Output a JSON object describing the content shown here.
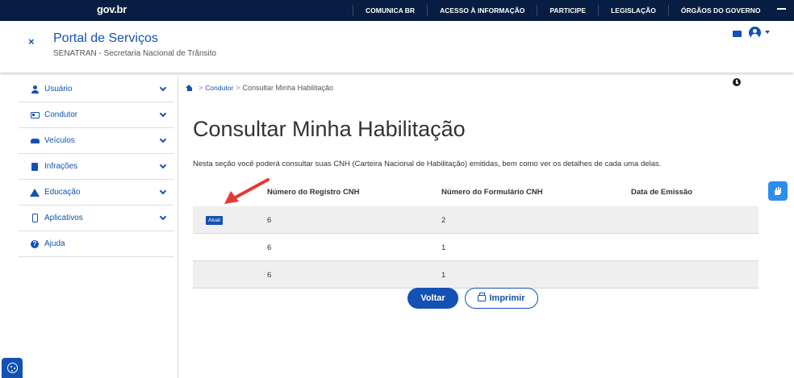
{
  "topbar": {
    "logo": "gov.br",
    "links": [
      "COMUNICA BR",
      "ACESSO À INFORMAÇÃO",
      "PARTICIPE",
      "LEGISLAÇÃO",
      "ÓRGÃOS DO GOVERNO"
    ]
  },
  "header": {
    "title": "Portal de Serviços",
    "subtitle": "SENATRAN - Secretaria Nacional de Trânsito",
    "close_symbol": "×"
  },
  "sidebar": {
    "items": [
      {
        "label": "Usuário",
        "icon": "user-icon"
      },
      {
        "label": "Condutor",
        "icon": "id-card-icon"
      },
      {
        "label": "Veículos",
        "icon": "car-icon"
      },
      {
        "label": "Infrações",
        "icon": "document-icon"
      },
      {
        "label": "Educação",
        "icon": "education-icon"
      },
      {
        "label": "Aplicativos",
        "icon": "phone-icon"
      },
      {
        "label": "Ajuda",
        "icon": "help-icon"
      }
    ]
  },
  "breadcrumb": {
    "separator": ">",
    "link": "Condutor",
    "current": "Consultar Minha Habilitação"
  },
  "main": {
    "title": "Consultar Minha Habilitação",
    "description": "Nesta seção você poderá consultar suas CNH (Carteira Nacional de Habilitação) emitidas, bem como ver os detalhes de cada uma delas."
  },
  "table": {
    "headers": [
      "Número do Registro CNH",
      "Número do Formulário CNH",
      "Data de Emissão"
    ],
    "rows": [
      {
        "badge": "Atual",
        "registro": "6",
        "formulario": "2",
        "emissao": ""
      },
      {
        "badge": "",
        "registro": "6",
        "formulario": "1",
        "emissao": ""
      },
      {
        "badge": "",
        "registro": "6",
        "formulario": "1",
        "emissao": ""
      }
    ]
  },
  "buttons": {
    "back": "Voltar",
    "print": "Imprimir"
  },
  "colors": {
    "primary": "#1351b4",
    "topbar": "#071d41",
    "annotation": "#e53935"
  }
}
